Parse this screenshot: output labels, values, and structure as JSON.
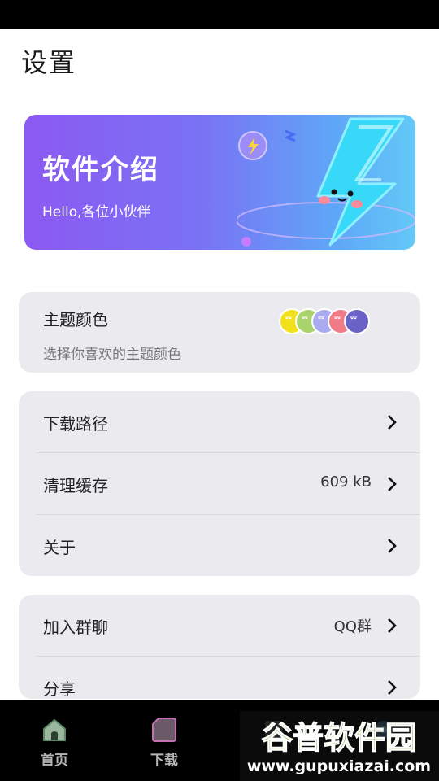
{
  "page": {
    "title": "设置"
  },
  "banner": {
    "title": "软件介绍",
    "subtitle": "Hello,各位小伙伴"
  },
  "theme": {
    "title": "主题颜色",
    "description": "选择你喜欢的主题颜色",
    "swatch_colors": [
      "#f2e11a",
      "#a9d36b",
      "#a9aaf0",
      "#f07a86",
      "#6a62c6"
    ]
  },
  "settings_group_1": {
    "items": [
      {
        "label": "下载路径",
        "value": ""
      },
      {
        "label": "清理缓存",
        "value": "609 kB"
      },
      {
        "label": "关于",
        "value": ""
      }
    ]
  },
  "settings_group_2": {
    "items": [
      {
        "label": "加入群聊",
        "value": "QQ群"
      },
      {
        "label": "分享",
        "value": ""
      }
    ]
  },
  "bottom_nav": {
    "items": [
      {
        "label": "首页",
        "icon": "home-icon"
      },
      {
        "label": "下载",
        "icon": "download-icon"
      },
      {
        "label": "",
        "icon": "tab-3-icon"
      },
      {
        "label": "",
        "icon": "settings-icon"
      }
    ]
  },
  "watermark": {
    "brand": "谷普软件园",
    "url": "www.gupuxiazai.com"
  },
  "colors": {
    "banner_start": "#8c59f2",
    "banner_end": "#63c9f7",
    "card_bg": "#ebebef",
    "nav_bg": "#000000"
  }
}
